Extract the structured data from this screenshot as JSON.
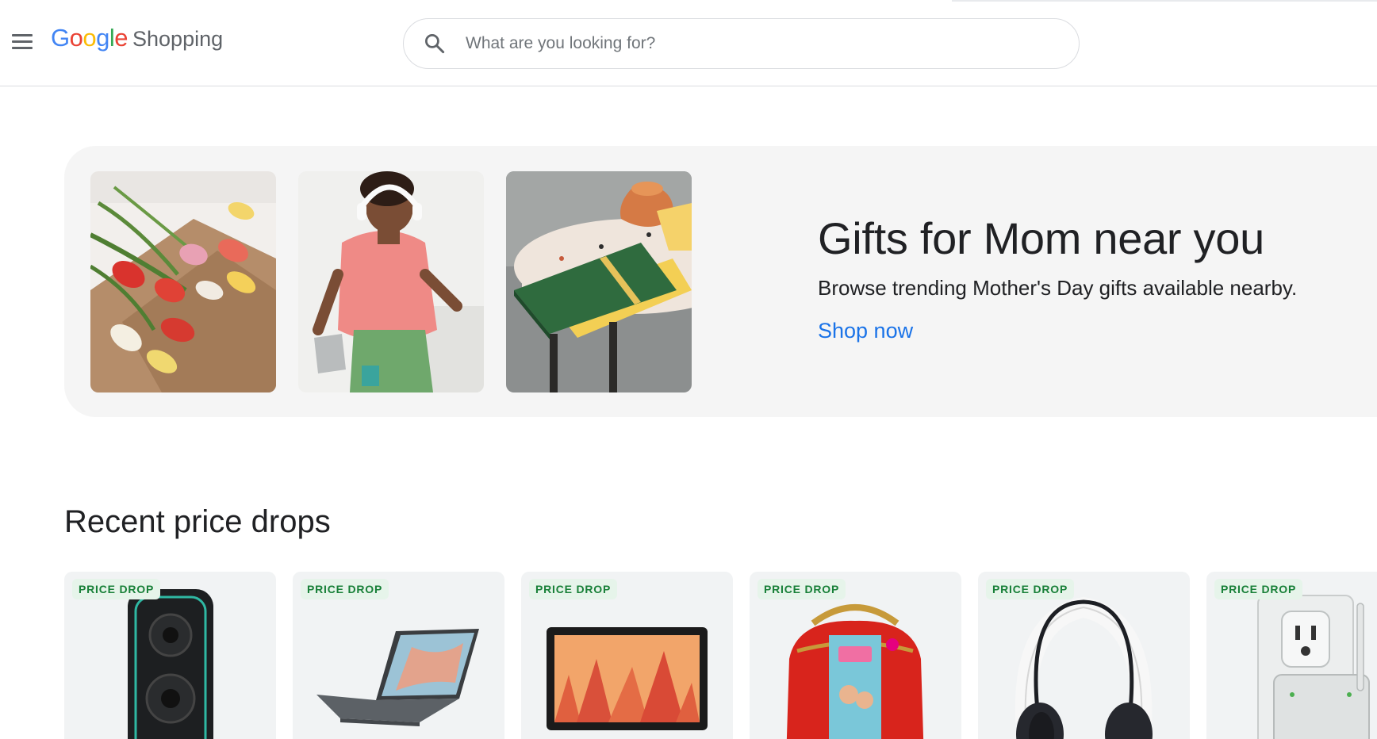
{
  "header": {
    "menu_icon": "hamburger-menu-icon",
    "logo": {
      "brand_letters": [
        "G",
        "o",
        "o",
        "g",
        "l",
        "e"
      ],
      "brand_colors": [
        "#4285F4",
        "#EA4335",
        "#FBBC05",
        "#4285F4",
        "#34A853",
        "#EA4335"
      ],
      "product": "Shopping"
    },
    "search": {
      "icon": "search-icon",
      "placeholder": "What are you looking for?",
      "value": ""
    }
  },
  "promo": {
    "title": "Gifts for Mom near you",
    "subtitle": "Browse trending Mother's Day gifts available nearby.",
    "link_label": "Shop now",
    "link_color": "#1a73e8",
    "images": [
      "tulips-photo",
      "woman-with-headphones-photo",
      "notebook-on-table-photo"
    ]
  },
  "price_drops": {
    "title": "Recent price drops",
    "badge_color": "#188038",
    "items": [
      {
        "badge": "PRICE DROP",
        "image": "party-speaker-image"
      },
      {
        "badge": "PRICE DROP",
        "image": "laptop-image"
      },
      {
        "badge": "PRICE DROP",
        "image": "tablet-image"
      },
      {
        "badge": "PRICE DROP",
        "image": "toy-doll-case-image"
      },
      {
        "badge": "PRICE DROP",
        "image": "headphones-image"
      },
      {
        "badge": "PRICE DROP",
        "image": "wifi-extender-image"
      }
    ]
  }
}
